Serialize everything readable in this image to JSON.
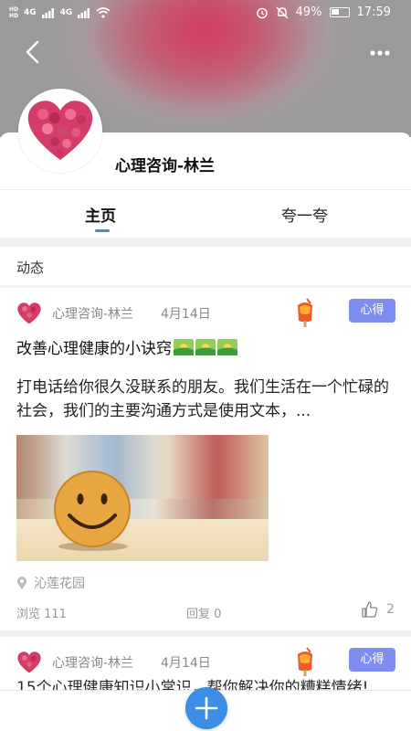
{
  "status_bar": {
    "left_tag_1": "HD",
    "left_tag_2": "HD",
    "signal_1": "4G",
    "signal_2": "4G",
    "battery": "49%",
    "battery_level": 0.49,
    "time": "17:59"
  },
  "profile": {
    "name": "心理咨询-林兰"
  },
  "tabs": [
    {
      "label": "主页",
      "active": true
    },
    {
      "label": "夸一夸",
      "active": false
    }
  ],
  "section": {
    "title": "动态"
  },
  "posts": [
    {
      "author": "心理咨询-林兰",
      "date": "4月14日",
      "tag": "心得",
      "title": "改善心理健康的小诀窍",
      "body": "打电话给你很久没联系的朋友。我们生活在一个忙碌的社会，我们的主要沟通方式是使用文本，...",
      "location": "沁莲花园",
      "views": "浏览 111",
      "replies": "回复 0",
      "likes": "2"
    },
    {
      "author": "心理咨询-林兰",
      "date": "4月14日",
      "tag": "心得",
      "title": "15个心理健康知识小常识，帮你解决你的糟糕情绪!"
    }
  ],
  "colors": {
    "accent": "#3b8de6",
    "tag_bg": "#7d8ef0",
    "muted_text": "#999999"
  },
  "icons": {
    "back": "back-arrow-icon",
    "more": "more-dots-icon",
    "location": "location-pin-icon",
    "like": "thumbs-up-icon",
    "add": "plus-icon"
  }
}
